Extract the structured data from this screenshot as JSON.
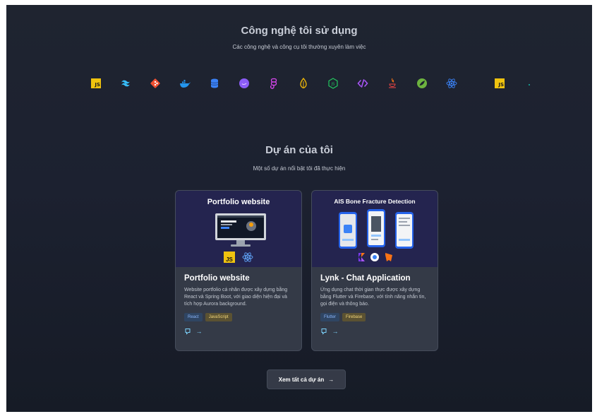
{
  "tech_section": {
    "title": "Công nghệ tôi sử dụng",
    "subtitle": "Các công nghệ và công cụ tôi thường xuyên làm việc",
    "icons": [
      {
        "name": "javascript-icon",
        "label": "JS",
        "color": "#f0c30f"
      },
      {
        "name": "tailwind-icon",
        "color": "#38bdf8"
      },
      {
        "name": "git-icon",
        "color": "#f05032"
      },
      {
        "name": "docker-icon",
        "color": "#2496ed"
      },
      {
        "name": "database-icon",
        "color": "#3b82f6"
      },
      {
        "name": "canva-icon",
        "color": "#8b5cf6"
      },
      {
        "name": "figma-icon",
        "color": "#d946ef"
      },
      {
        "name": "mongodb-icon",
        "color": "#eab308"
      },
      {
        "name": "nodejs-icon",
        "color": "#22c55e"
      },
      {
        "name": "html-code-icon",
        "color": "#a855f7"
      },
      {
        "name": "java-icon",
        "color": "#f97316"
      },
      {
        "name": "spring-icon",
        "color": "#6db33f"
      },
      {
        "name": "react-icon",
        "color": "#3b82f6"
      },
      {
        "name": "javascript-icon-2",
        "label": "JS",
        "color": "#f0c30f"
      },
      {
        "name": "dot-icon",
        "color": "#14b8a6"
      }
    ]
  },
  "projects_section": {
    "title": "Dự án của tôi",
    "subtitle": "Một số dự án nổi bật tôi đã thực hiện",
    "projects": [
      {
        "image_title": "Portfolio website",
        "title": "Portfolio website",
        "description": "Website portfolio cá nhân được xây dựng bằng React và Spring Boot, với giao diện hiện đại và tích hợp Aurora background.",
        "tags": [
          "React",
          "JavaScript"
        ]
      },
      {
        "image_title": "AIS Bone Fracture Detection",
        "title": "Lynk - Chat Application",
        "description": "Ứng dụng chat thời gian thực được xây dựng bằng Flutter và Firebase, với tính năng nhắn tin, gọi điện và thông báo.",
        "tags": [
          "Flutter",
          "Firebase"
        ]
      }
    ],
    "view_all_label": "Xem tất cả dự án",
    "arrow": "→",
    "js_label": "JS"
  }
}
